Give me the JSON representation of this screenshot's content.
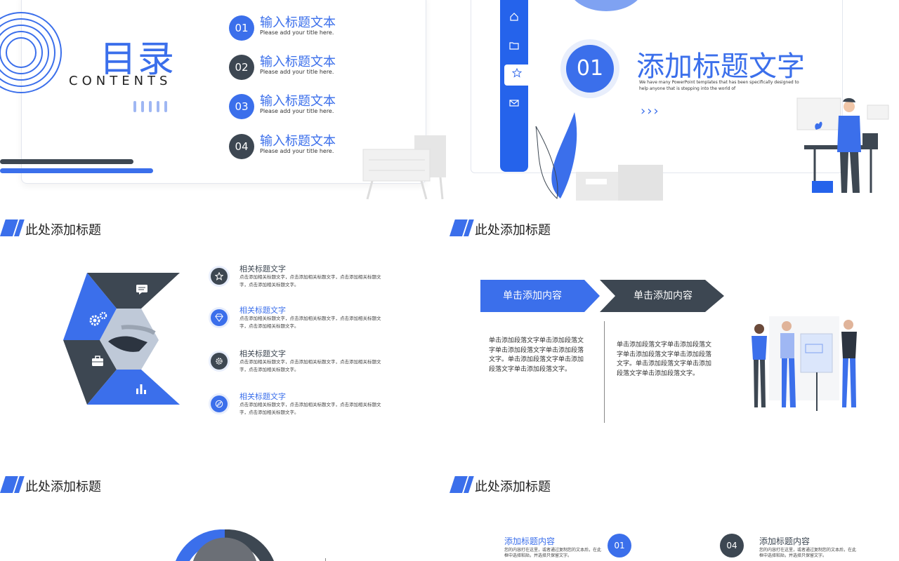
{
  "colors": {
    "primary": "#3B6FEB",
    "dark": "#3D4752",
    "sidebar": "#2563EB"
  },
  "slide1": {
    "title_cn": "目录",
    "title_en": "CONTENTS",
    "items": [
      {
        "num": "01",
        "title": "输入标题文本",
        "sub": "Please add your title here."
      },
      {
        "num": "02",
        "title": "输入标题文本",
        "sub": "Please add your title here."
      },
      {
        "num": "03",
        "title": "输入标题文本",
        "sub": "Please add your title here."
      },
      {
        "num": "04",
        "title": "输入标题文本",
        "sub": "Please add your title here."
      }
    ]
  },
  "slide2": {
    "sidebar_icons": [
      "home-icon",
      "folder-icon",
      "star-icon",
      "mail-icon"
    ],
    "number": "01",
    "headline": "添加标题文字",
    "desc": "We have many PowerPoint templates that has been specifically designed to help anyone that is stepping into the world of",
    "chevrons": "›››"
  },
  "slide3": {
    "section_title": "此处添加标题",
    "hex_icons": [
      "chat-icon",
      "gears-icon",
      "briefcase-icon",
      "bar-chart-icon"
    ],
    "features": [
      {
        "title": "相关标题文字",
        "desc": "点击添加相关标题文字，点击添加相关标题文字，点击添加相关标题文字，点击添加相关标题文字。",
        "icon": "star-icon"
      },
      {
        "title": "相关标题文字",
        "desc": "点击添加相关标题文字，点击添加相关标题文字，点击添加相关标题文字，点击添加相关标题文字。",
        "icon": "diamond-icon"
      },
      {
        "title": "相关标题文字",
        "desc": "点击添加相关标题文字，点击添加相关标题文字，点击添加相关标题文字，点击添加相关标题文字。",
        "icon": "gear-icon"
      },
      {
        "title": "相关标题文字",
        "desc": "点击添加相关标题文字，点击添加相关标题文字，点击添加相关标题文字，点击添加相关标题文字。",
        "icon": "compass-icon"
      }
    ]
  },
  "slide4": {
    "section_title": "此处添加标题",
    "arrows": [
      "单击添加内容",
      "单击添加内容"
    ],
    "paras": [
      "单击添加段落文字单击添加段落文字单击添加段落文字单击添加段落文字。单击添加段落文字单击添加段落文字单击添加段落文字。",
      "单击添加段落文字单击添加段落文字单击添加段落文字单击添加段落文字。单击添加段落文字单击添加段落文字单击添加段落文字。"
    ]
  },
  "slide5": {
    "section_title": "此处添加标题"
  },
  "slide6": {
    "section_title": "此处添加标题",
    "left": {
      "title": "添加标题内容",
      "desc": "您的内容打在这里，或者通过复制您的文本后，在此框中选择粘贴，并选择只保留文字。",
      "num": "01"
    },
    "right": {
      "title": "添加标题内容",
      "desc": "您的内容打在这里，或者通过复制您的文本后，在此框中选择粘贴，并选择只保留文字。",
      "num": "04"
    }
  }
}
